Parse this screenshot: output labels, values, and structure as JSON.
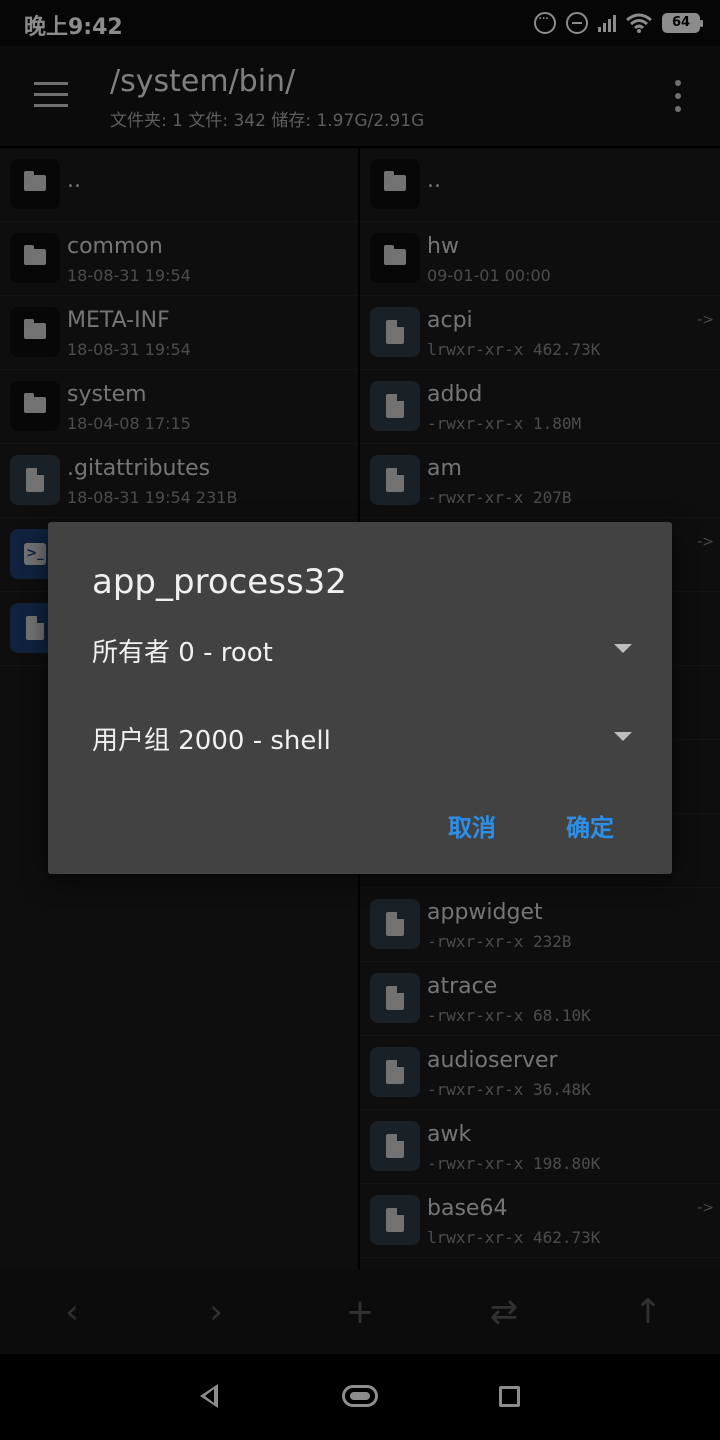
{
  "status_bar": {
    "time": "晚上9:42",
    "battery": "64"
  },
  "header": {
    "path": "/system/bin/",
    "info": "文件夹: 1  文件: 342  储存: 1.97G/2.91G"
  },
  "left_pane": [
    {
      "name": "..",
      "detail": "",
      "type": "folder"
    },
    {
      "name": "common",
      "detail": "18-08-31 19:54",
      "type": "folder"
    },
    {
      "name": "META-INF",
      "detail": "18-08-31 19:54",
      "type": "folder"
    },
    {
      "name": "system",
      "detail": "18-04-08 17:15",
      "type": "folder"
    },
    {
      "name": ".gitattributes",
      "detail": "18-08-31 19:54  231B",
      "type": "file"
    }
  ],
  "right_pane": [
    {
      "name": "..",
      "detail": "",
      "type": "folder"
    },
    {
      "name": "hw",
      "detail": "09-01-01 00:00",
      "type": "folder"
    },
    {
      "name": "acpi",
      "detail": "lrwxr-xr-x 462.73K",
      "type": "file",
      "arrow": "->"
    },
    {
      "name": "adbd",
      "detail": "-rwxr-xr-x 1.80M",
      "type": "file"
    },
    {
      "name": "am",
      "detail": "-rwxr-xr-x 207B",
      "type": "file"
    },
    {
      "name": "appwidget",
      "detail": "-rwxr-xr-x 232B",
      "type": "file"
    },
    {
      "name": "atrace",
      "detail": "-rwxr-xr-x 68.10K",
      "type": "file"
    },
    {
      "name": "audioserver",
      "detail": "-rwxr-xr-x 36.48K",
      "type": "file"
    },
    {
      "name": "awk",
      "detail": "-rwxr-xr-x 198.80K",
      "type": "file"
    },
    {
      "name": "base64",
      "detail": "lrwxr-xr-x 462.73K",
      "type": "file",
      "arrow": "->"
    }
  ],
  "partial_arrow": "->",
  "dialog": {
    "title": "app_process32",
    "owner_label": "所有者  0 - root",
    "group_label": "用户组  2000 - shell",
    "cancel": "取消",
    "ok": "确定"
  },
  "toolbar_icons": [
    "back-icon",
    "forward-icon",
    "add-icon",
    "swap-icon",
    "up-arrow-icon"
  ]
}
